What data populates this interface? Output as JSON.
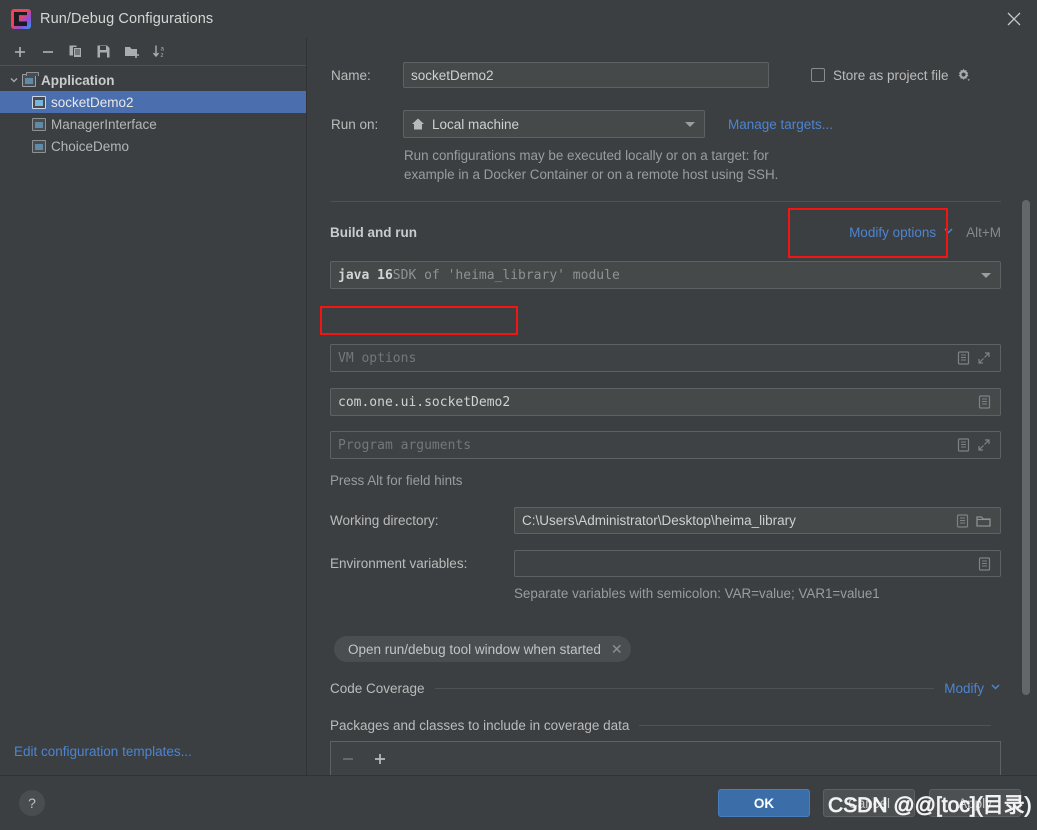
{
  "window": {
    "title": "Run/Debug Configurations",
    "app_icon": "intellij-idea-icon",
    "close_icon": "close-icon"
  },
  "left_panel": {
    "toolbar": [
      {
        "name": "add-configuration-button",
        "icon": "plus-icon"
      },
      {
        "name": "remove-configuration-button",
        "icon": "minus-icon"
      },
      {
        "name": "copy-configuration-button",
        "icon": "copy-icon"
      },
      {
        "name": "save-configuration-button",
        "icon": "save-icon"
      },
      {
        "name": "move-into-folder-button",
        "icon": "folder-plus-icon"
      },
      {
        "name": "sort-configurations-button",
        "icon": "sort-az-icon"
      }
    ],
    "tree": {
      "group_label": "Application",
      "items": [
        {
          "label": "socketDemo2",
          "selected": true
        },
        {
          "label": "ManagerInterface",
          "selected": false
        },
        {
          "label": "ChoiceDemo",
          "selected": false
        }
      ]
    },
    "edit_templates_link": "Edit configuration templates..."
  },
  "form": {
    "name_label": "Name:",
    "name_value": "socketDemo2",
    "store_as_project_file_label": "Store as project file",
    "store_as_project_file_checked": false,
    "store_gear_icon": "gear-icon",
    "run_on_label": "Run on:",
    "run_on_value": "Local machine",
    "run_on_icon": "home-icon",
    "manage_targets_link": "Manage targets...",
    "run_on_description_line1": "Run configurations may be executed locally or on a target: for",
    "run_on_description_line2": "example in a Docker Container or on a remote host using SSH.",
    "build_and_run_label": "Build and run",
    "modify_options_link": "Modify options",
    "modify_options_shortcut": "Alt+M",
    "jre_value_bold": "java 16",
    "jre_value_rest": " SDK of 'heima_library' module",
    "vm_options_placeholder": "VM options",
    "main_class_value": "com.one.ui.socketDemo2",
    "program_arguments_placeholder": "Program arguments",
    "field_hints_text": "Press Alt for field hints",
    "working_directory_label": "Working directory:",
    "working_directory_value": "C:\\Users\\Administrator\\Desktop\\heima_library",
    "environment_variables_label": "Environment variables:",
    "environment_variables_value": "",
    "environment_variables_hint": "Separate variables with semicolon: VAR=value; VAR1=value1",
    "open_tool_window_tag": "Open run/debug tool window when started",
    "tag_close_icon": "close-icon",
    "code_coverage_label": "Code Coverage",
    "code_coverage_modify_link": "Modify",
    "coverage_packages_label": "Packages and classes to include in coverage data",
    "coverage_remove_icon": "minus-icon",
    "coverage_add_icon": "plus-icon",
    "macro_icon": "macro-list-icon",
    "expand_icon": "expand-arrows-icon",
    "browse_icon": "folder-browse-icon",
    "dropdown_icon": "chevron-down-icon"
  },
  "footer": {
    "help_label": "?",
    "ok_label": "OK",
    "cancel_label": "Cancel",
    "apply_label": "Apply"
  },
  "watermark": "CSDN @@[toc](目录)",
  "colors": {
    "background": "#3c3f41",
    "selection_blue": "#4b6eaf",
    "link_blue": "#4d84d1",
    "primary_button": "#3b6ea8",
    "annotation_red": "#f31414",
    "field_background": "#45494a"
  }
}
